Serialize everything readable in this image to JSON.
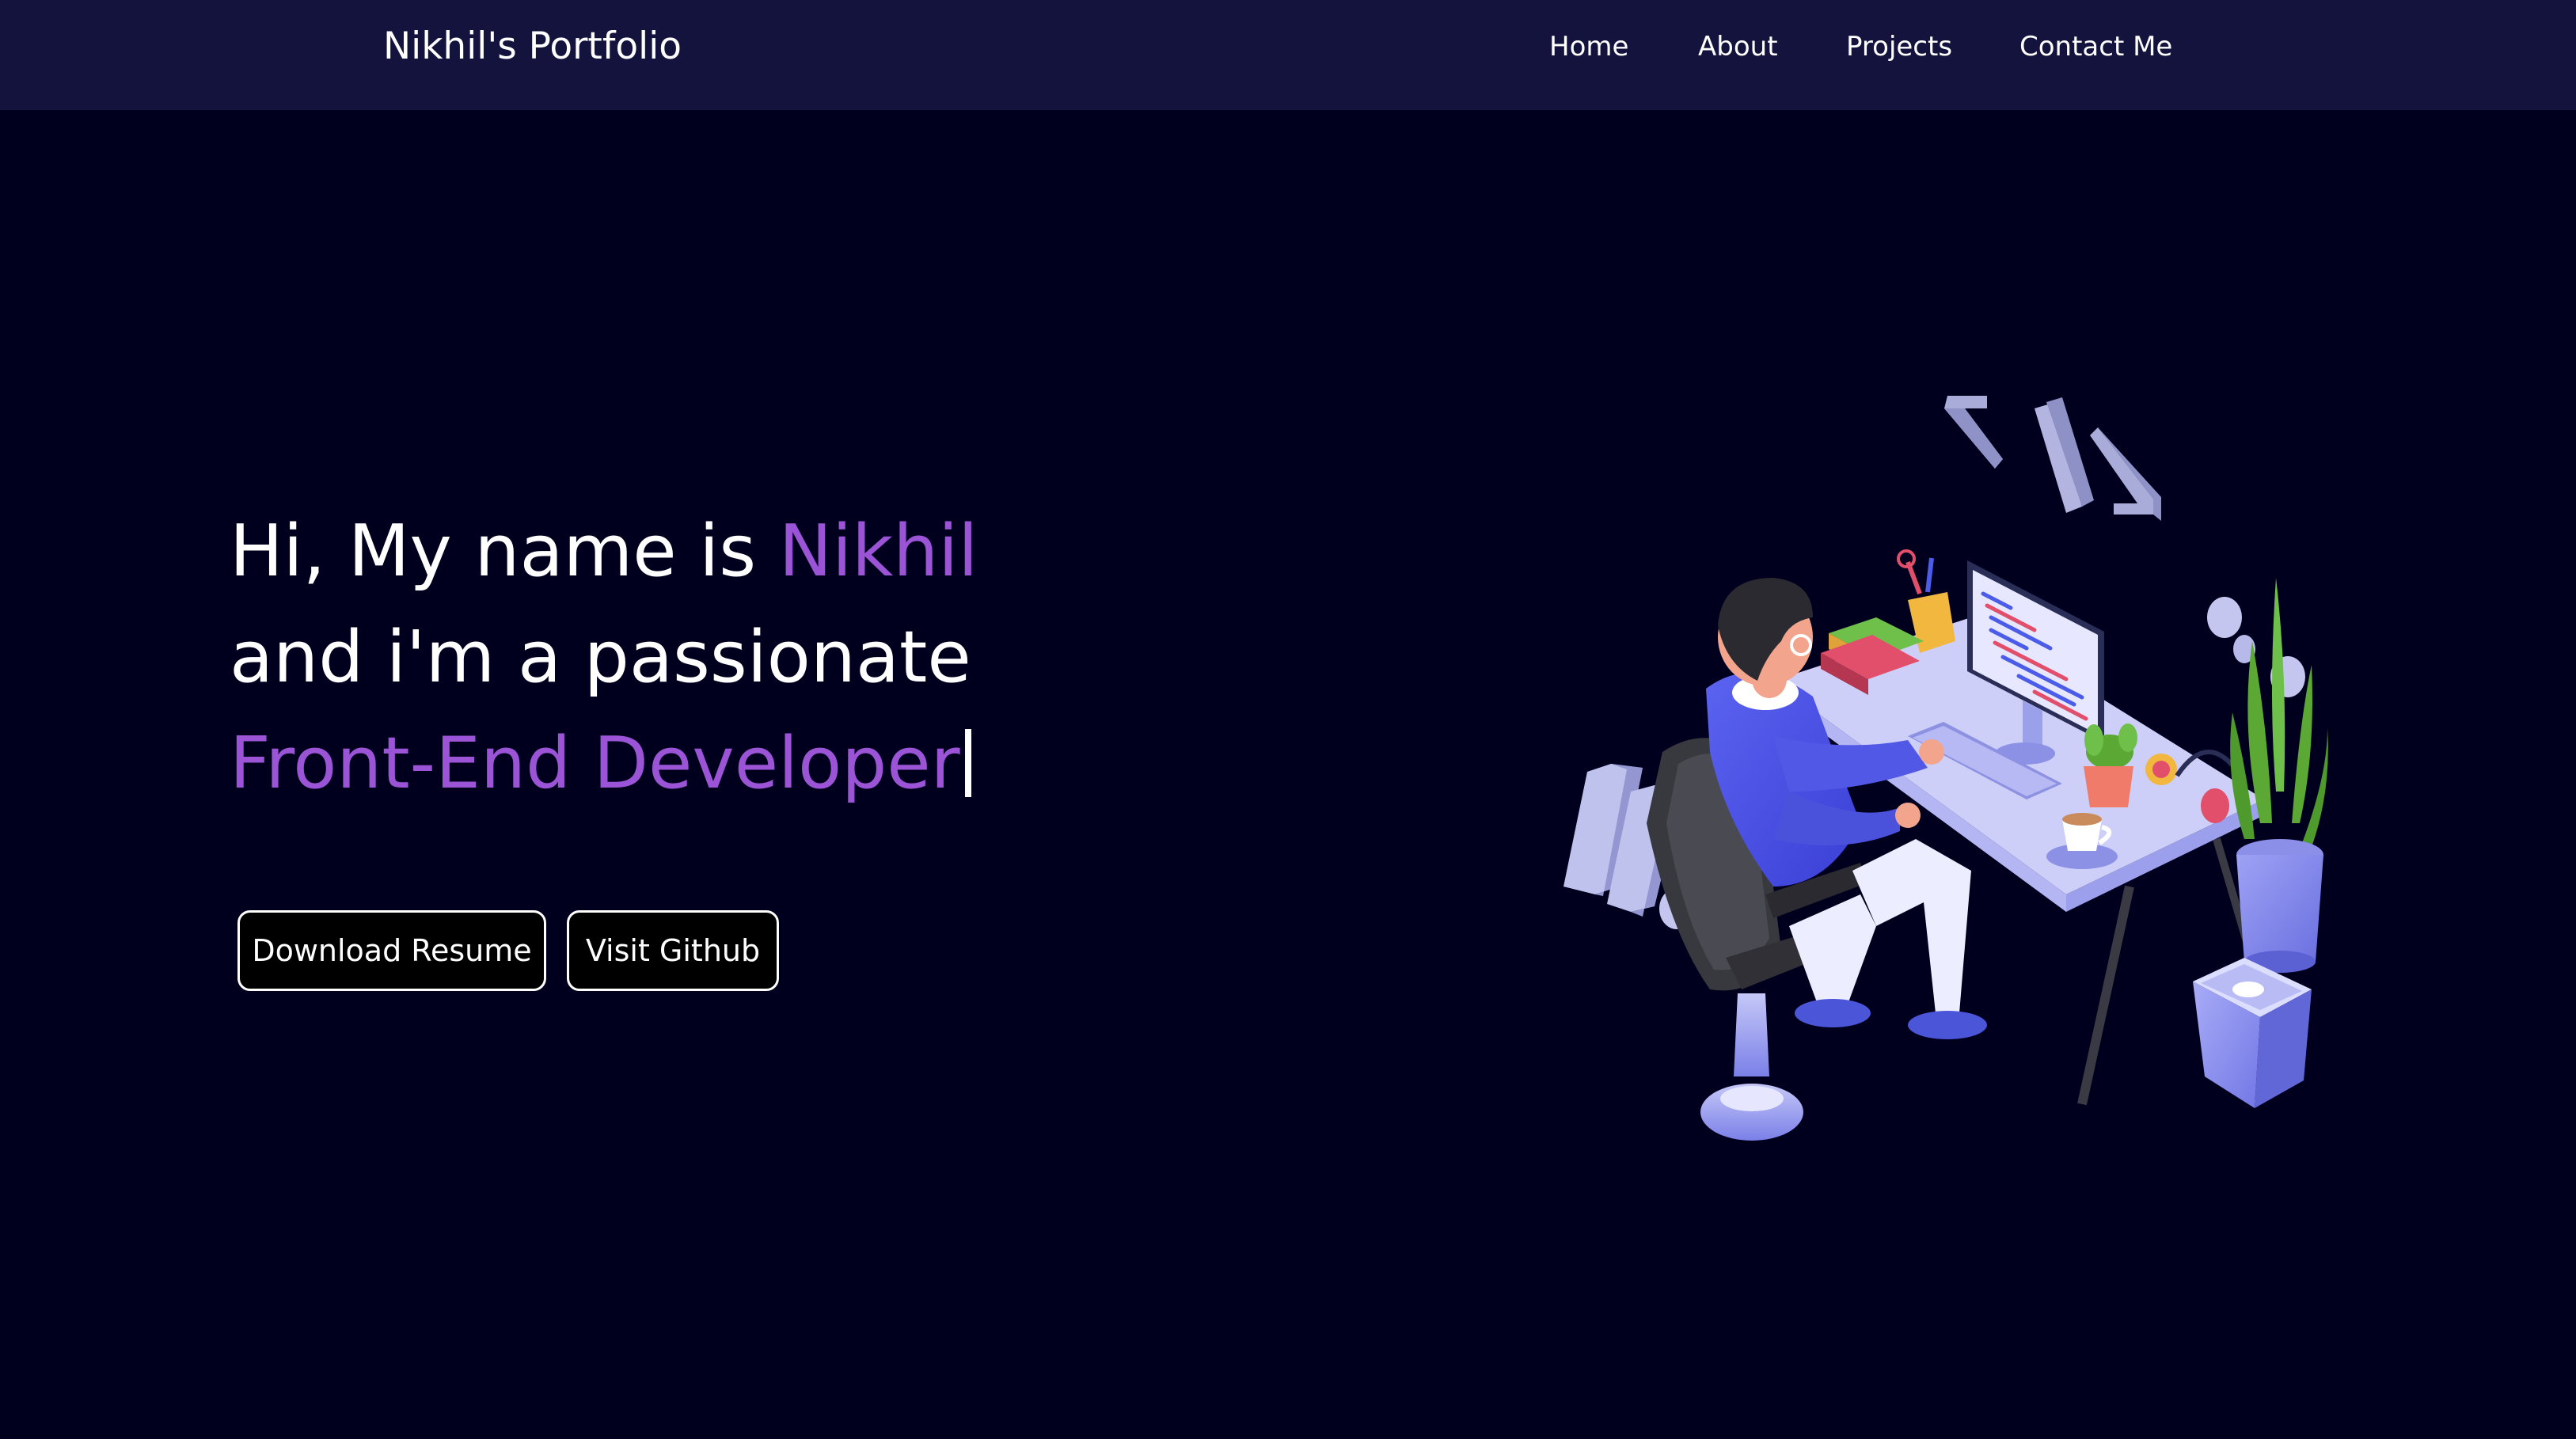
{
  "navbar": {
    "brand": "Nikhil's Portfolio",
    "links": [
      "Home",
      "About",
      "Projects",
      "Contact Me"
    ]
  },
  "hero": {
    "greeting": "Hi, My name is ",
    "name": "Nikhil",
    "line2": "and i'm a passionate",
    "role": "Front-End Developer"
  },
  "buttons": {
    "resume": "Download Resume",
    "github": "Visit Github"
  },
  "colors": {
    "background": "#00001e",
    "navbar": "#13133d",
    "accent": "#9c54d6",
    "text": "#ffffff"
  },
  "illustration": {
    "subject": "developer at desk illustration",
    "icons": [
      "code-brackets-icon",
      "computer-monitor-icon",
      "plant-icon",
      "office-chair-icon",
      "trash-bin-icon"
    ]
  }
}
